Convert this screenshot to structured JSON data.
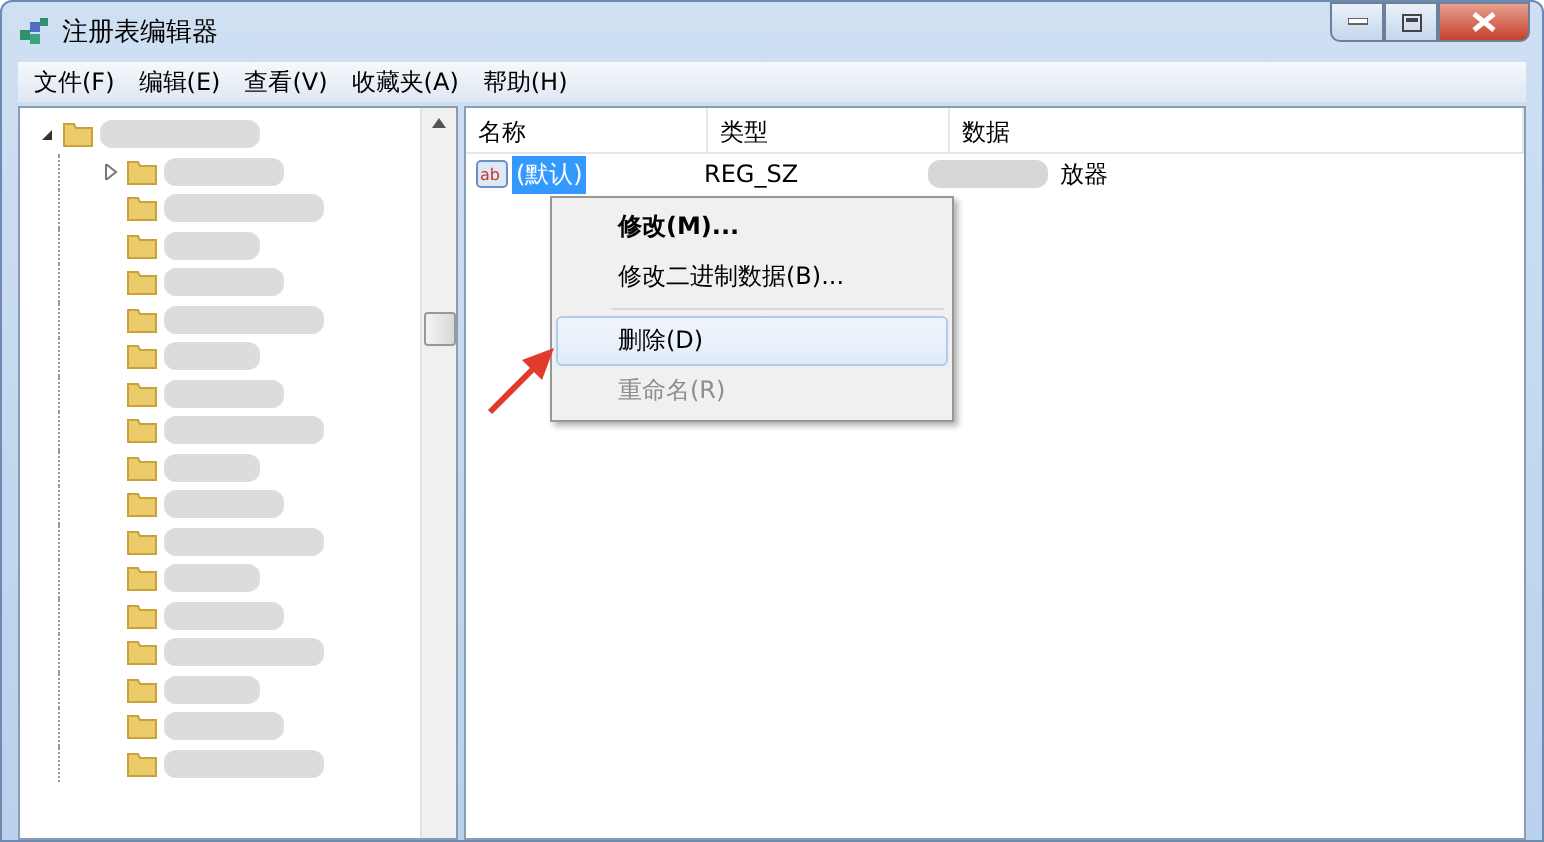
{
  "window": {
    "title": "注册表编辑器"
  },
  "menu": [
    "文件(F)",
    "编辑(E)",
    "查看(V)",
    "收藏夹(A)",
    "帮助(H)"
  ],
  "tree": {
    "expanded": true,
    "children": [
      {
        "kind": "folder",
        "expandable": true
      },
      {
        "kind": "folder",
        "expandable": false
      },
      {
        "kind": "folder",
        "expandable": false
      },
      {
        "kind": "folder",
        "expandable": false
      },
      {
        "kind": "folder",
        "expandable": false
      },
      {
        "kind": "folder",
        "expandable": false
      },
      {
        "kind": "folder",
        "expandable": false
      },
      {
        "kind": "folder",
        "expandable": false
      },
      {
        "kind": "folder",
        "expandable": false
      },
      {
        "kind": "folder",
        "expandable": false
      },
      {
        "kind": "folder",
        "expandable": false
      },
      {
        "kind": "folder",
        "expandable": false
      },
      {
        "kind": "folder",
        "expandable": false
      },
      {
        "kind": "folder",
        "expandable": false
      },
      {
        "kind": "folder",
        "expandable": false
      },
      {
        "kind": "folder",
        "expandable": false
      },
      {
        "kind": "folder",
        "expandable": false
      }
    ]
  },
  "table": {
    "columns": [
      "名称",
      "类型",
      "数据"
    ],
    "rows": [
      {
        "icon_text": "ab",
        "name": "(默认)",
        "type": "REG_SZ",
        "data": "放器",
        "selected": true
      }
    ]
  },
  "context_menu": [
    {
      "label": "修改(M)...",
      "kind": "item",
      "default": true,
      "disabled": false,
      "selected": false
    },
    {
      "label": "修改二进制数据(B)...",
      "kind": "item",
      "default": false,
      "disabled": false,
      "selected": false
    },
    {
      "kind": "separator"
    },
    {
      "label": "删除(D)",
      "kind": "item",
      "default": false,
      "disabled": false,
      "selected": true
    },
    {
      "label": "重命名(R)",
      "kind": "item",
      "default": false,
      "disabled": true,
      "selected": false
    }
  ]
}
